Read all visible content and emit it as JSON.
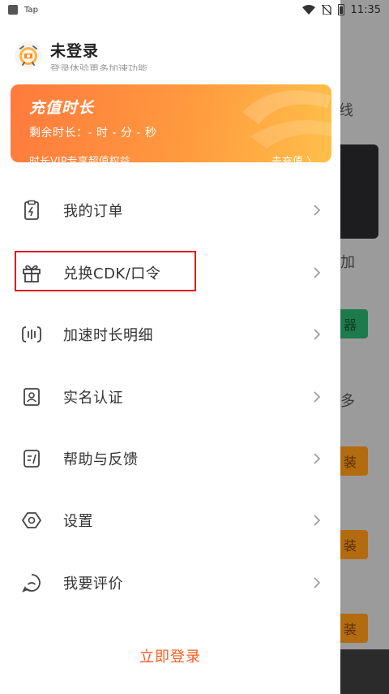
{
  "status_bar": {
    "app_label": "Tap",
    "time": "11:35"
  },
  "background": {
    "text_right_1": "线",
    "text_right_2": "加",
    "text_right_3": "多",
    "green_btn": "器",
    "pill_label": "装"
  },
  "profile": {
    "name": "未登录",
    "subtitle": "登录体验更多加速功能"
  },
  "recharge": {
    "title": "充值时长",
    "remaining": "剩余时长：- 时 - 分 - 秒",
    "vip_text": "时长VIP专享超值权益",
    "go_label": "去充值 〉"
  },
  "menu": {
    "items": [
      {
        "label": "我的订单",
        "icon": "order-icon"
      },
      {
        "label": "兑换CDK/口令",
        "icon": "gift-icon"
      },
      {
        "label": "加速时长明细",
        "icon": "speed-detail-icon"
      },
      {
        "label": "实名认证",
        "icon": "id-card-icon"
      },
      {
        "label": "帮助与反馈",
        "icon": "feedback-icon"
      },
      {
        "label": "设置",
        "icon": "settings-icon"
      },
      {
        "label": "我要评价",
        "icon": "rate-icon"
      }
    ]
  },
  "login_label": "立即登录",
  "colors": {
    "accent": "#ff5a1f",
    "highlight": "#e01a1a",
    "card_start": "#ff7a3d",
    "card_end": "#ffbf4a"
  }
}
